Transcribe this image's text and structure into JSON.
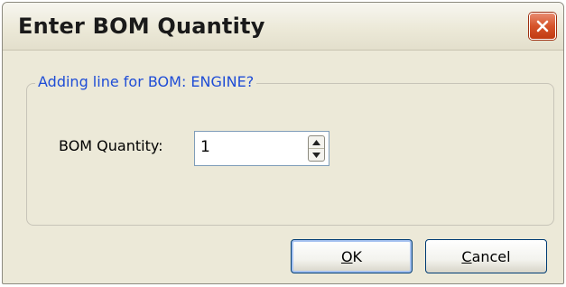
{
  "dialog": {
    "title": "Enter BOM Quantity",
    "close_icon": "close-icon"
  },
  "group": {
    "legend": "Adding line for BOM: ENGINE?"
  },
  "quantity": {
    "label": "BOM Quantity:",
    "value": "1"
  },
  "buttons": {
    "ok_mnemonic": "O",
    "ok_rest": "K",
    "cancel_mnemonic": "C",
    "cancel_rest": "ancel"
  },
  "colors": {
    "legend_text": "#1f4dd6",
    "dialog_bg": "#ece9d8",
    "close_button": "#d6532a"
  }
}
